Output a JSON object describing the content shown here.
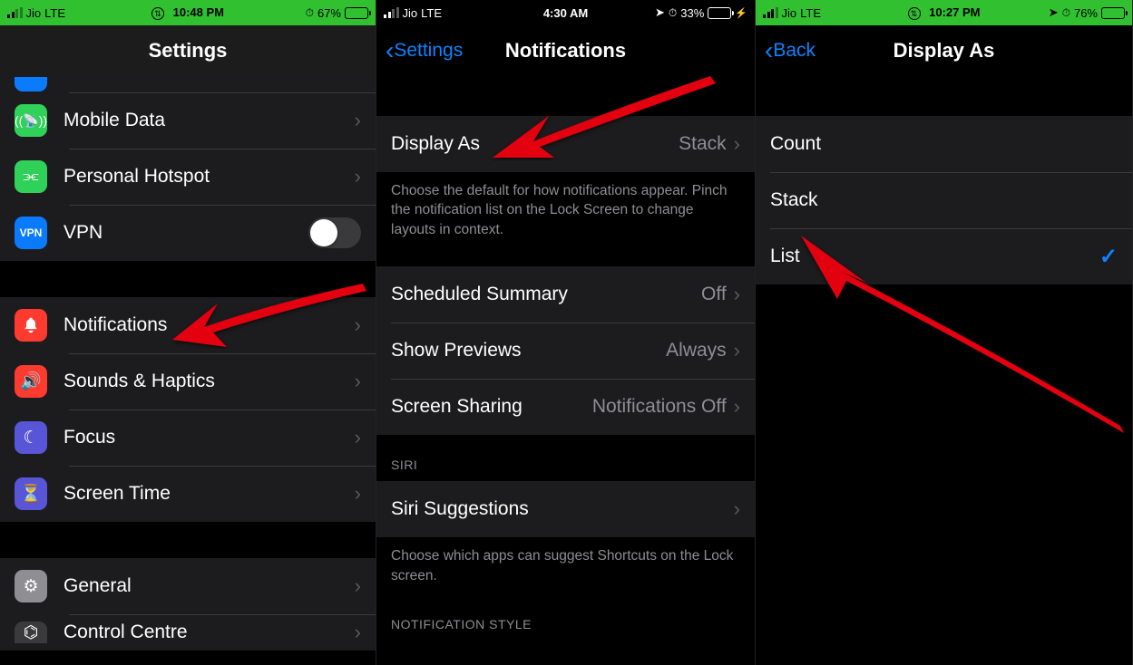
{
  "s1": {
    "status": {
      "carrier": "Jio",
      "net": "LTE",
      "time": "10:48 PM",
      "battery_pct": "67%",
      "battery_fill": 67
    },
    "title": "Settings",
    "rows_g1": [
      {
        "name": "mobile-data",
        "label": "Mobile Data",
        "icon": "antenna-icon",
        "ic": "ic-green",
        "glyph": "📶"
      },
      {
        "name": "personal-hotspot",
        "label": "Personal Hotspot",
        "icon": "link-icon",
        "ic": "ic-greenD",
        "glyph": "🔗"
      },
      {
        "name": "vpn",
        "label": "VPN",
        "icon": "vpn-icon",
        "ic": "ic-blue",
        "glyph": "VPN",
        "toggle": true
      }
    ],
    "rows_g2": [
      {
        "name": "notifications",
        "label": "Notifications",
        "icon": "bell-icon",
        "ic": "ic-red",
        "glyph": "🔔"
      },
      {
        "name": "sounds-haptics",
        "label": "Sounds & Haptics",
        "icon": "speaker-icon",
        "ic": "ic-red",
        "glyph": "🔊"
      },
      {
        "name": "focus",
        "label": "Focus",
        "icon": "moon-icon",
        "ic": "ic-purple",
        "glyph": "☾"
      },
      {
        "name": "screen-time",
        "label": "Screen Time",
        "icon": "hourglass-icon",
        "ic": "ic-purple",
        "glyph": "⏳"
      }
    ],
    "rows_g3": [
      {
        "name": "general",
        "label": "General",
        "icon": "gear-icon",
        "ic": "ic-gray",
        "glyph": "⚙"
      },
      {
        "name": "control-centre",
        "label": "Control Centre",
        "icon": "switches-icon",
        "ic": "ic-darkgray",
        "glyph": "⌬"
      }
    ]
  },
  "s2": {
    "status": {
      "carrier": "Jio",
      "net": "LTE",
      "time": "4:30 AM",
      "battery_pct": "33%",
      "battery_fill": 33
    },
    "back": "Settings",
    "title": "Notifications",
    "rows_g1": [
      {
        "name": "display-as",
        "label": "Display As",
        "detail": "Stack"
      }
    ],
    "footer1": "Choose the default for how notifications appear. Pinch the notification list on the Lock Screen to change layouts in context.",
    "rows_g2": [
      {
        "name": "scheduled-summary",
        "label": "Scheduled Summary",
        "detail": "Off"
      },
      {
        "name": "show-previews",
        "label": "Show Previews",
        "detail": "Always"
      },
      {
        "name": "screen-sharing",
        "label": "Screen Sharing",
        "detail": "Notifications Off"
      }
    ],
    "header_siri": "SIRI",
    "rows_g3": [
      {
        "name": "siri-suggestions",
        "label": "Siri Suggestions"
      }
    ],
    "footer2": "Choose which apps can suggest Shortcuts on the Lock screen.",
    "header_style": "NOTIFICATION STYLE"
  },
  "s3": {
    "status": {
      "carrier": "Jio",
      "net": "LTE",
      "time": "10:27 PM",
      "battery_pct": "76%",
      "battery_fill": 76
    },
    "back": "Back",
    "title": "Display As",
    "rows": [
      {
        "name": "count-option",
        "label": "Count",
        "checked": false
      },
      {
        "name": "stack-option",
        "label": "Stack",
        "checked": false
      },
      {
        "name": "list-option",
        "label": "List",
        "checked": true
      }
    ]
  }
}
